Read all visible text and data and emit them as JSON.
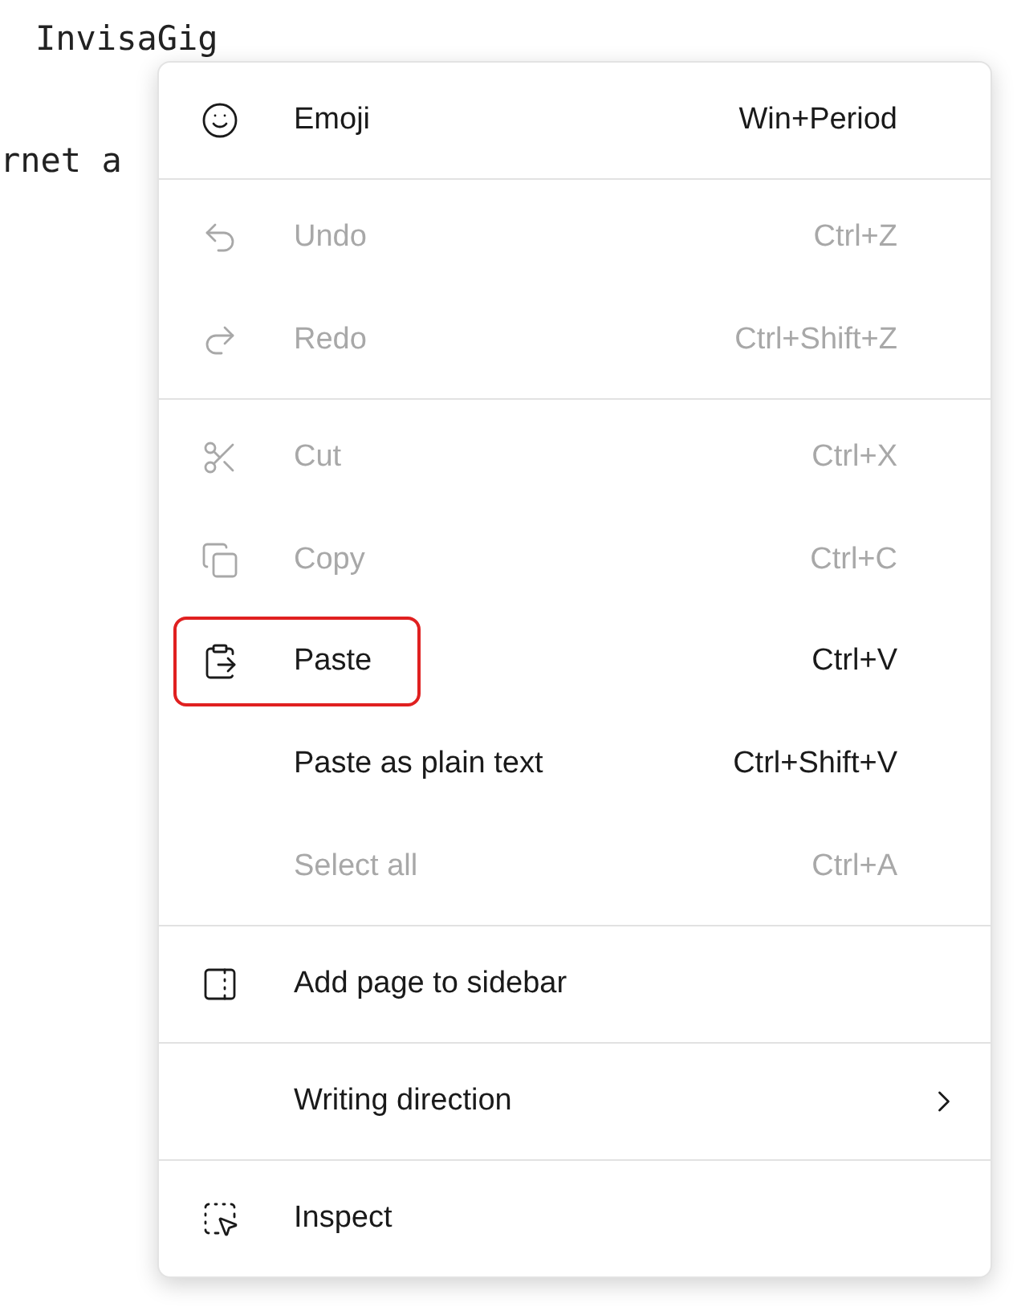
{
  "background_text": [
    "InvisaGig",
    "rnet a"
  ],
  "menu": {
    "groups": [
      {
        "items": [
          {
            "label": "Emoji",
            "shortcut": "Win+Period",
            "disabled": false,
            "highlighted": false
          }
        ]
      },
      {
        "items": [
          {
            "label": "Undo",
            "shortcut": "Ctrl+Z",
            "disabled": true,
            "highlighted": false
          },
          {
            "label": "Redo",
            "shortcut": "Ctrl+Shift+Z",
            "disabled": true,
            "highlighted": false
          }
        ]
      },
      {
        "items": [
          {
            "label": "Cut",
            "shortcut": "Ctrl+X",
            "disabled": true,
            "highlighted": false
          },
          {
            "label": "Copy",
            "shortcut": "Ctrl+C",
            "disabled": true,
            "highlighted": false
          },
          {
            "label": "Paste",
            "shortcut": "Ctrl+V",
            "disabled": false,
            "highlighted": true
          },
          {
            "label": "Paste as plain text",
            "shortcut": "Ctrl+Shift+V",
            "disabled": false,
            "highlighted": false
          },
          {
            "label": "Select all",
            "shortcut": "Ctrl+A",
            "disabled": true,
            "highlighted": false
          }
        ]
      },
      {
        "items": [
          {
            "label": "Add page to sidebar",
            "disabled": false,
            "highlighted": false
          }
        ]
      },
      {
        "items": [
          {
            "label": "Writing direction",
            "disabled": false,
            "highlighted": false,
            "submenu": true
          }
        ]
      },
      {
        "items": [
          {
            "label": "Inspect",
            "disabled": false,
            "highlighted": false
          }
        ]
      }
    ]
  }
}
